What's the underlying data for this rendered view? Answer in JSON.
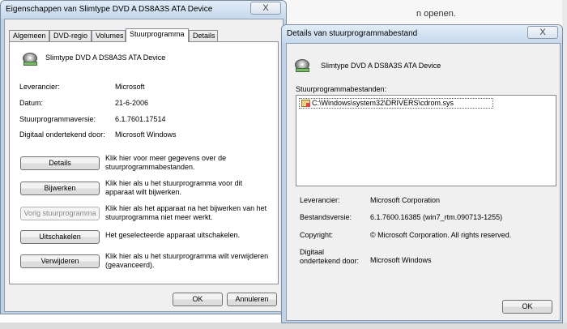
{
  "background": {
    "text": "n openen."
  },
  "left_window": {
    "title": "Eigenschappen van Slimtype DVD A  DS8A3S ATA Device",
    "close": "X",
    "tabs": [
      "Algemeen",
      "DVD-regio",
      "Volumes",
      "Stuurprogramma",
      "Details"
    ],
    "active_tab": "Stuurprogramma",
    "device_name": "Slimtype DVD A  DS8A3S ATA Device",
    "fields": [
      {
        "label": "Leverancier:",
        "value": "Microsoft"
      },
      {
        "label": "Datum:",
        "value": "21-6-2006"
      },
      {
        "label": "Stuurprogrammaversie:",
        "value": "6.1.7601.17514"
      },
      {
        "label": "Digitaal ondertekend door:",
        "value": "Microsoft Windows"
      }
    ],
    "actions": [
      {
        "label": "Details",
        "description": "Klik hier voor meer gegevens over de stuurprogrammabestanden."
      },
      {
        "label": "Bijwerken",
        "description": "Klik hier als u het stuurprogramma voor dit apparaat wilt bijwerken."
      },
      {
        "label": "Vorig stuurprogramma",
        "description": "Klik hier als het apparaat na het bijwerken van het stuurprogramma niet meer werkt."
      },
      {
        "label": "Uitschakelen",
        "description": "Het geselecteerde apparaat uitschakelen."
      },
      {
        "label": "Verwijderen",
        "description": "Klik hier als u het stuurprogramma wilt verwijderen (geavanceerd)."
      }
    ],
    "ok": "OK",
    "cancel": "Annuleren"
  },
  "right_window": {
    "title": "Details van stuurprogrammabestand",
    "close": "X",
    "device_name": "Slimtype DVD A  DS8A3S ATA Device",
    "files_label": "Stuurprogrammabestanden:",
    "files": [
      "C:\\Windows\\system32\\DRIVERS\\cdrom.sys"
    ],
    "fields": [
      {
        "label": "Leverancier:",
        "value": "Microsoft Corporation"
      },
      {
        "label": "Bestandsversie:",
        "value": "6.1.7600.16385 (win7_rtm.090713-1255)"
      },
      {
        "label": "Copyright:",
        "value": "© Microsoft Corporation. All rights reserved."
      },
      {
        "label": "Digitaal ondertekend door:",
        "value": "Microsoft Windows"
      }
    ],
    "ok": "OK"
  }
}
